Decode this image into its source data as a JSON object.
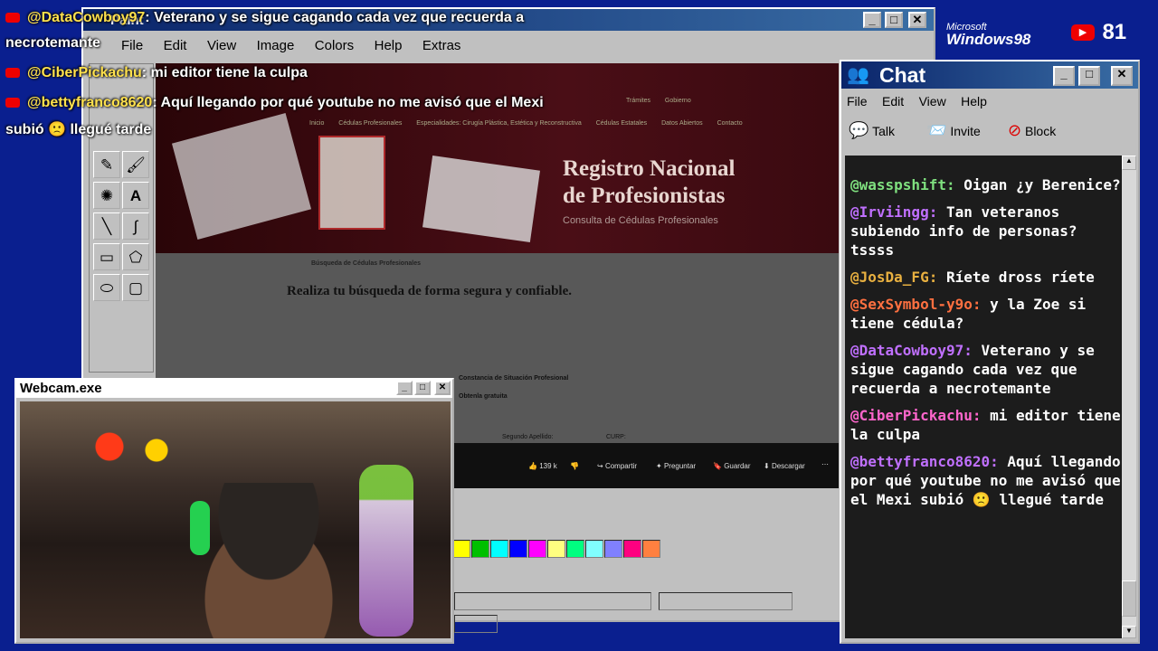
{
  "paint": {
    "title": "Paint",
    "menu": [
      "File",
      "Edit",
      "View",
      "Image",
      "Colors",
      "Help",
      "Extras"
    ],
    "palette_colors": [
      "#ffff00",
      "#00c000",
      "#00ffff",
      "#0000ff",
      "#ff00ff",
      "#ffff80",
      "#00ff80",
      "#80ffff",
      "#8080ff",
      "#ff0080",
      "#ff8040"
    ]
  },
  "embedded_page": {
    "heading_line1": "Registro Nacional",
    "heading_line2": "de Profesionistas",
    "subtitle": "Consulta de Cédulas Profesionales",
    "search_heading": "Realiza tu búsqueda de forma segura y confiable.",
    "breadcrumb": "Búsqueda de Cédulas Profesionales",
    "nav_items": [
      "Inicio",
      "Cédulas Profesionales",
      "Especialidades: Cirugía Plástica, Estética y Reconstructiva",
      "Cédulas Estatales",
      "Datos Abiertos",
      "Contacto"
    ],
    "top_links": [
      "Trámites",
      "Gobierno"
    ],
    "notice": "Constancia de Situación Profesional",
    "notice2": "Obtenla gratuita",
    "field_labels": [
      "Segundo Apellido:",
      "CURP:"
    ],
    "video_actions": [
      "139 k",
      "Compartir",
      "Preguntar",
      "Guardar",
      "Descargar"
    ]
  },
  "overlay_chat": [
    {
      "user": "@DataCowboy97",
      "text": ": Veterano y se sigue cagando cada vez que recuerda a",
      "continuation": "necrotemante"
    },
    {
      "user": "@CiberPickachu",
      "text": ": mi editor tiene la culpa",
      "continuation": ""
    },
    {
      "user": "@bettyfranco8620",
      "text": ": Aquí llegando por qué youtube no me avisó que el Mexi",
      "continuation": "subió 🙁 llegué tarde"
    }
  ],
  "badge": {
    "brand_small": "Microsoft",
    "brand": "Windows98",
    "live_count": "81"
  },
  "chat": {
    "title": "Chat",
    "menu": [
      "File",
      "Edit",
      "View",
      "Help"
    ],
    "toolbar": {
      "talk": "Talk",
      "invite": "Invite",
      "block": "Block"
    },
    "messages": [
      {
        "user": "@wasspshift:",
        "text": "Oigan ¿y Berenice?",
        "color": "#7fe07f"
      },
      {
        "user": "@Irviingg:",
        "text": "Tan veteranos subiendo info de personas? tssss",
        "color": "#c070ff"
      },
      {
        "user": "@JosDa_FG:",
        "text": "Ríete dross ríete",
        "color": "#e8b040"
      },
      {
        "user": "@SexSymbol-y9o:",
        "text": "y la Zoe si tiene cédula?",
        "color": "#ff7040"
      },
      {
        "user": "@DataCowboy97:",
        "text": "Veterano y se sigue cagando cada vez que recuerda a necrotemante",
        "color": "#c070ff"
      },
      {
        "user": "@CiberPickachu:",
        "text": "mi editor tiene la culpa",
        "color": "#ff66cc"
      },
      {
        "user": "@bettyfranco8620:",
        "text": "Aquí llegando por qué youtube no me avisó que el Mexi subió 🙁 llegué tarde",
        "color": "#c070ff"
      }
    ]
  },
  "webcam": {
    "title": "Webcam.exe"
  }
}
